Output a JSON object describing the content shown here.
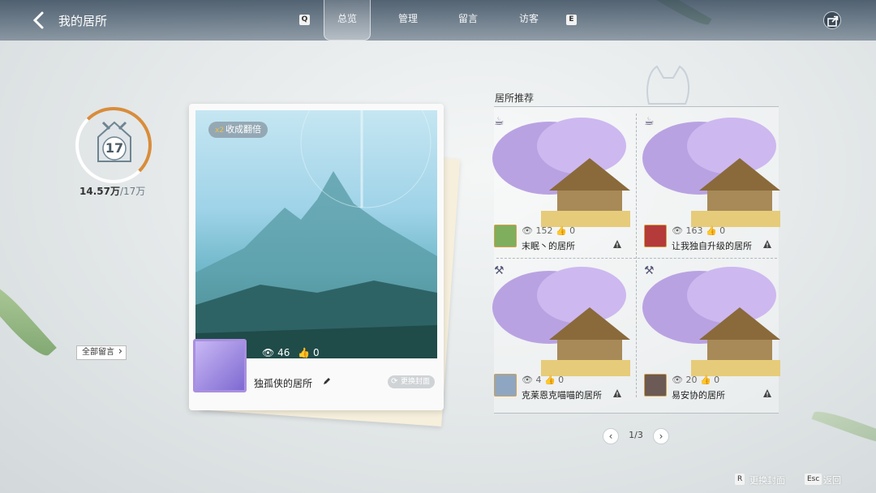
{
  "header": {
    "title": "我的居所",
    "left_key": "Q",
    "right_key": "E",
    "tabs": [
      {
        "label": "总览",
        "active": true
      },
      {
        "label": "管理",
        "active": false
      },
      {
        "label": "留言",
        "active": false
      },
      {
        "label": "访客",
        "active": false
      }
    ]
  },
  "level": {
    "value": "17",
    "progress_current": "14.57万",
    "progress_max": "/17万",
    "progress_fraction": 0.857
  },
  "all_comments_label": "全部留言",
  "main_card": {
    "double_prefix": "x2",
    "double_label": "收成翻倍",
    "views": "46",
    "likes": "0",
    "owner_name": "独孤侠的居所",
    "change_cover_label": "更换封面"
  },
  "recommend": {
    "title": "居所推荐",
    "items": [
      {
        "views": "152",
        "likes": "0",
        "name": "末眠丶的居所",
        "category_icon": "teapot-icon",
        "avatar_color": "#7fae5d"
      },
      {
        "views": "163",
        "likes": "0",
        "name": "让我独自升级的居所",
        "category_icon": "teapot-icon",
        "avatar_color": "#b53a3a"
      },
      {
        "views": "4",
        "likes": "0",
        "name": "克莱恩克喵喵的居所",
        "category_icon": "sickle-icon",
        "avatar_color": "#8fa6c2"
      },
      {
        "views": "20",
        "likes": "0",
        "name": "易安协的居所",
        "category_icon": "sickle-icon",
        "avatar_color": "#6b5a55"
      }
    ],
    "pager": {
      "text": "1/3",
      "prev": "‹",
      "next": "›"
    }
  },
  "footer": [
    {
      "key": "R",
      "label": "更换封面"
    },
    {
      "key": "Esc",
      "label": "返回"
    }
  ],
  "colors": {
    "accent": "#d98c3a",
    "panel": "#fafafa"
  }
}
